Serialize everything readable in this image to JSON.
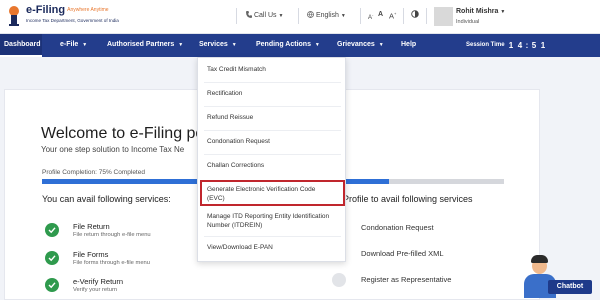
{
  "header": {
    "brand": "e-Filing",
    "brand_tag": "Anywhere Anytime",
    "brand_sub": "Income Tax Department, Government of India",
    "call_us": "Call Us",
    "language": "English",
    "font_small": "A",
    "font_normal": "A",
    "font_large": "A",
    "user_name": "Rohit Mishra",
    "user_role": "Individual"
  },
  "nav": {
    "items": [
      "Dashboard",
      "e-File",
      "Authorised Partners",
      "Services",
      "Pending Actions",
      "Grievances",
      "Help"
    ],
    "session_label": "Session Time",
    "timer": [
      "1",
      "4",
      ":",
      "5",
      "1"
    ]
  },
  "main": {
    "welcome": "Welcome to e-Filing po",
    "tagline": "Your one step solution to Income Tax Ne",
    "profile_completion": "Profile Completion: 75% Completed",
    "profile_percent": 75,
    "avail_left": "You can avail following services:",
    "avail_right": "Profile to avail following services",
    "services": [
      {
        "title": "File Return",
        "desc": "File return through e-file menu"
      },
      {
        "title": "File Forms",
        "desc": "File forms through e-file menu"
      },
      {
        "title": "e-Verify Return",
        "desc": "Verify your return"
      }
    ],
    "right_services": [
      "Condonation Request",
      "Download Pre-filled XML",
      "Register as Representative"
    ]
  },
  "dropdown": {
    "items": [
      "Tax Credit Mismatch",
      "Rectification",
      "Refund Reissue",
      "Condonation Request",
      "Challan Corrections",
      "Generate Electronic Verification Code",
      "(EVC)",
      "Manage ITD Reporting Entity Identification",
      "Number (ITDREIN)",
      "View/Download E-PAN"
    ],
    "highlight_color": "#c0262d"
  },
  "chatbot": {
    "label": "Chatbot"
  },
  "colors": {
    "nav_bg": "#233d8c",
    "progress_fill": "#2e6fd6",
    "check_green": "#2f9a4d"
  }
}
